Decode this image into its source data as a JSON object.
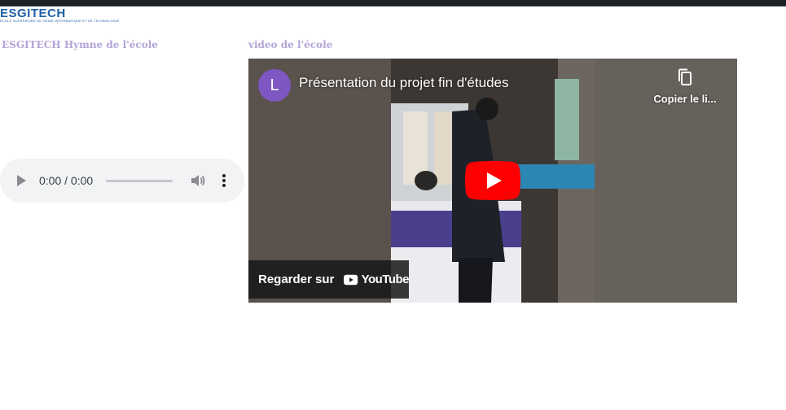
{
  "header": {
    "logo_text": "ESGITECH",
    "logo_subtext": "ÉCOLE SUPÉRIEURE DE GÉNIE INFORMATIQUE ET DE TECHNOLOGIE"
  },
  "audio_section": {
    "heading": "ESGITECH Hymne de l'école",
    "player": {
      "time": "0:00 / 0:00",
      "progress": 0
    }
  },
  "video_section": {
    "heading": "video de l'école",
    "embed": {
      "channel_initial": "L",
      "title": "Présentation du projet fin d'études",
      "copy_link_label": "Copier le li...",
      "watch_on_label": "Regarder sur",
      "youtube_word": "YouTube"
    }
  },
  "colors": {
    "heading": "#b3a4d6",
    "logo": "#1f5fa8",
    "avatar": "#7e57c2",
    "youtube_red": "#ff0000",
    "player_bg": "#f1f3f4"
  }
}
